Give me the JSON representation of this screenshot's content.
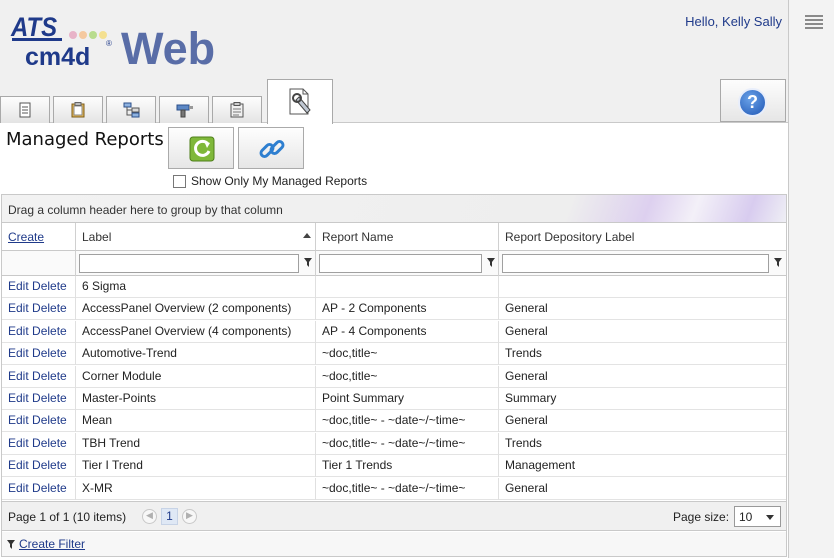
{
  "header": {
    "logo_top": "ATS",
    "logo_bottom": "cm4d",
    "logo_reg": "®",
    "logo_web": "Web",
    "greeting": "Hello, Kelly Sally"
  },
  "tabs": [
    {
      "icon": "document-icon"
    },
    {
      "icon": "clipboard-icon"
    },
    {
      "icon": "hierarchy-icon"
    },
    {
      "icon": "drill-icon"
    },
    {
      "icon": "clipboard-list-icon"
    },
    {
      "icon": "document-wrench-icon",
      "active": true
    }
  ],
  "help": {
    "label": "?"
  },
  "page": {
    "title": "Managed Reports",
    "show_only_mine": "Show Only My Managed Reports",
    "show_only_mine_checked": false
  },
  "grid": {
    "group_panel": "Drag a column header here to group by that column",
    "columns": {
      "create": "Create",
      "label": "Label",
      "report_name": "Report Name",
      "depository": "Report Depository Label"
    },
    "sort": {
      "column": "label",
      "direction": "ascending"
    },
    "actions": {
      "edit": "Edit",
      "delete": "Delete"
    },
    "rows": [
      {
        "label": "6 Sigma",
        "report_name": "",
        "depository": ""
      },
      {
        "label": "AccessPanel Overview (2 components)",
        "report_name": "AP - 2 Components",
        "depository": "General"
      },
      {
        "label": "AccessPanel Overview (4 components)",
        "report_name": "AP - 4 Components",
        "depository": "General"
      },
      {
        "label": "Automotive-Trend",
        "report_name": "~doc,title~",
        "depository": "Trends"
      },
      {
        "label": "Corner Module",
        "report_name": "~doc,title~",
        "depository": "General"
      },
      {
        "label": "Master-Points",
        "report_name": "Point Summary",
        "depository": "Summary"
      },
      {
        "label": "Mean",
        "report_name": "~doc,title~ - ~date~/~time~",
        "depository": "General"
      },
      {
        "label": "TBH Trend",
        "report_name": "~doc,title~ - ~date~/~time~",
        "depository": "Trends"
      },
      {
        "label": "Tier I Trend",
        "report_name": "Tier 1 Trends",
        "depository": "Management"
      },
      {
        "label": "X-MR",
        "report_name": "~doc,title~ - ~date~/~time~",
        "depository": "General"
      }
    ],
    "pager": {
      "info": "Page 1 of 1 (10 items)",
      "current_page": "1",
      "page_size_label": "Page size:",
      "page_size": "10"
    },
    "footer": {
      "create_filter": "Create Filter"
    }
  }
}
